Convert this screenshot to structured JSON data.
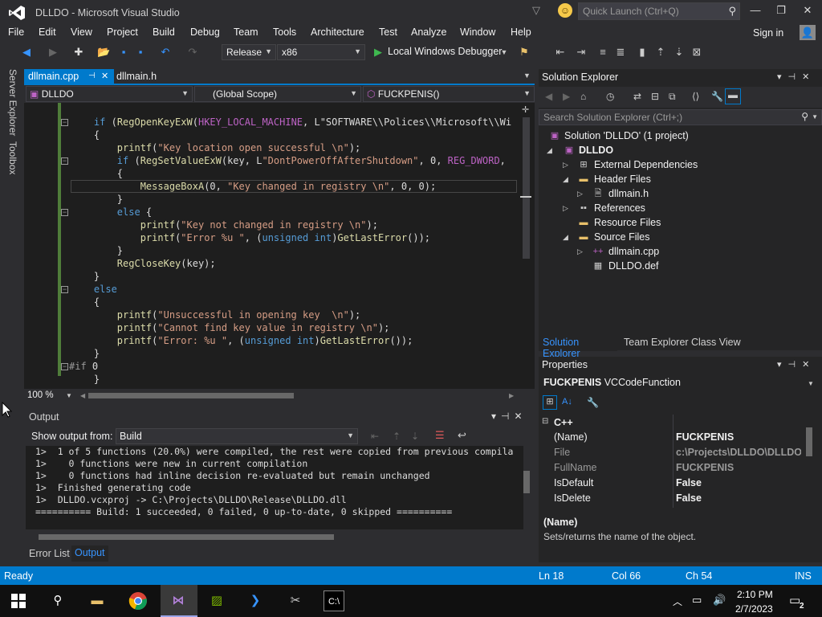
{
  "window": {
    "title": "DLLDO - Microsoft Visual Studio",
    "quick_launch_placeholder": "Quick Launch (Ctrl+Q)"
  },
  "menu": [
    "File",
    "Edit",
    "View",
    "Project",
    "Build",
    "Debug",
    "Team",
    "Tools",
    "Architecture",
    "Test",
    "Analyze",
    "Window",
    "Help"
  ],
  "account": {
    "signin": "Sign in"
  },
  "toolbar": {
    "configuration": "Release",
    "platform": "x86",
    "debugger": "Local Windows Debugger"
  },
  "left_tabs": [
    "Server Explorer",
    "Toolbox"
  ],
  "editor": {
    "tabs": [
      "dllmain.cpp",
      "dllmain.h"
    ],
    "nav": {
      "project": "DLLDO",
      "scope": "(Global Scope)",
      "member": "FUCKPENIS()"
    },
    "zoom": "100 %",
    "lines": [
      "    if (RegOpenKeyExW(HKEY_LOCAL_MACHINE, L\"SOFTWARE\\\\Polices\\\\Microsoft\\\\Wi",
      "    {",
      "        printf(\"Key location open successful \\n\");",
      "        if (RegSetValueExW(key, L\"DontPowerOffAfterShutdown\", 0, REG_DWORD,",
      "        {",
      "            MessageBoxA(0, \"Key changed in registry \\n\", 0, 0);",
      "        }",
      "        else {",
      "            printf(\"Key not changed in registry \\n\");",
      "            printf(\"Error %u \", (unsigned int)GetLastError());",
      "        }",
      "        RegCloseKey(key);",
      "    }",
      "    else",
      "    {",
      "        printf(\"Unsuccessful in opening key  \\n\");",
      "        printf(\"Cannot find key value in registry \\n\");",
      "        printf(\"Error: %u \", (unsigned int)GetLastError());",
      "    }",
      "#if 0",
      "    }"
    ]
  },
  "output": {
    "title": "Output",
    "show_output_from_label": "Show output from:",
    "source": "Build",
    "lines": [
      "1>  1 of 5 functions (20.0%) were compiled, the rest were copied from previous compila",
      "1>    0 functions were new in current compilation",
      "1>    0 functions had inline decision re-evaluated but remain unchanged",
      "1>  Finished generating code",
      "1>  DLLDO.vcxproj -> C:\\Projects\\DLLDO\\Release\\DLLDO.dll",
      "========== Build: 1 succeeded, 0 failed, 0 up-to-date, 0 skipped =========="
    ],
    "tabs": [
      "Error List",
      "Output"
    ]
  },
  "solution_explorer": {
    "title": "Solution Explorer",
    "search_placeholder": "Search Solution Explorer (Ctrl+;)",
    "tree": [
      "Solution 'DLLDO' (1 project)",
      "DLLDO",
      "External Dependencies",
      "Header Files",
      "dllmain.h",
      "References",
      "Resource Files",
      "Source Files",
      "dllmain.cpp",
      "DLLDO.def"
    ],
    "tabs": [
      "Solution Explorer",
      "Team Explorer",
      "Class View"
    ]
  },
  "properties": {
    "title": "Properties",
    "object_name": "FUCKPENIS",
    "object_type": "VCCodeFunction",
    "category": "C++",
    "rows": [
      {
        "name": "(Name)",
        "value": "FUCKPENIS"
      },
      {
        "name": "File",
        "value": "c:\\Projects\\DLLDO\\DLLDO\\dllmain.cpp"
      },
      {
        "name": "FullName",
        "value": "FUCKPENIS"
      },
      {
        "name": "IsDefault",
        "value": "False"
      },
      {
        "name": "IsDelete",
        "value": "False"
      }
    ],
    "desc_name": "(Name)",
    "desc_text": "Sets/returns the name of the object."
  },
  "status": {
    "ready": "Ready",
    "ln": "Ln 18",
    "col": "Col 66",
    "ch": "Ch 54",
    "ins": "INS"
  },
  "taskbar": {
    "time": "2:10 PM",
    "date": "2/7/2023",
    "notification_count": "2"
  },
  "colors": {
    "accent": "#007acc",
    "editor_bg": "#1e1e1e",
    "panel_bg": "#252526",
    "chrome_bg": "#2d2d30"
  }
}
